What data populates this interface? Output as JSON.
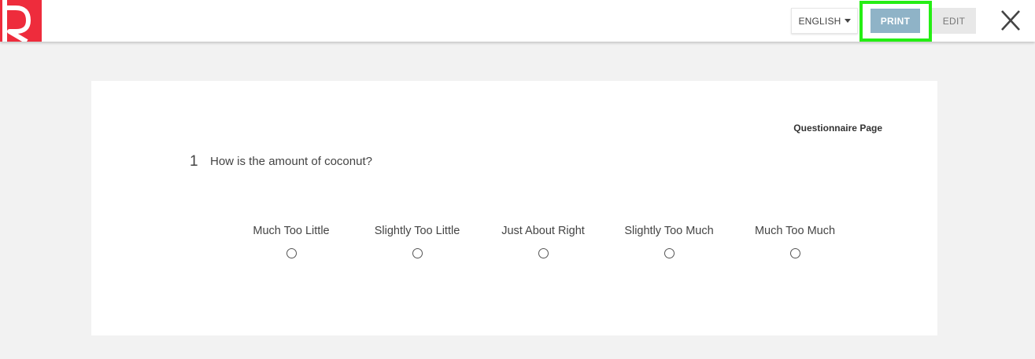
{
  "header": {
    "logo_letter": "R",
    "language_label": "ENGLISH",
    "print_label": "PRINT",
    "edit_label": "EDIT"
  },
  "colors": {
    "brand_red": "#ee2c3c",
    "print_button": "#8fb3c7",
    "highlight": "#25ee14",
    "page_background": "#f2f2f2"
  },
  "questionnaire": {
    "page_label": "Questionnaire Page",
    "question_number": "1",
    "question_text": "How is the amount of coconut?",
    "options": [
      {
        "label": "Much Too Little",
        "selected": false
      },
      {
        "label": "Slightly Too Little",
        "selected": false
      },
      {
        "label": "Just About Right",
        "selected": false
      },
      {
        "label": "Slightly Too Much",
        "selected": false
      },
      {
        "label": "Much Too Much",
        "selected": false
      }
    ]
  }
}
